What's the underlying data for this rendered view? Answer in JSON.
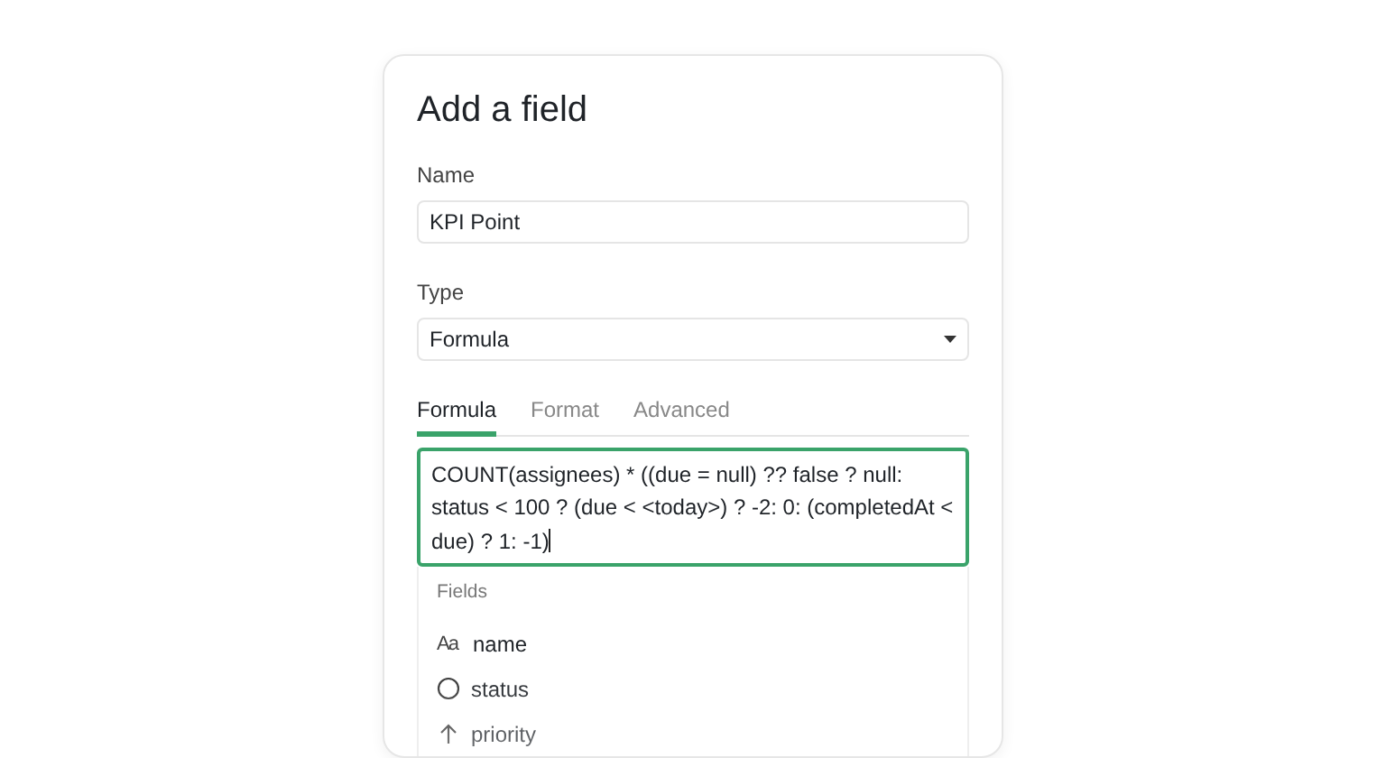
{
  "dialog": {
    "title": "Add a field"
  },
  "name_field": {
    "label": "Name",
    "value": "KPI Point"
  },
  "type_field": {
    "label": "Type",
    "value": "Formula"
  },
  "tabs": [
    {
      "label": "Formula",
      "selected": true
    },
    {
      "label": "Format",
      "selected": false
    },
    {
      "label": "Advanced",
      "selected": false
    }
  ],
  "formula": {
    "value": "COUNT(assignees) * ((due = null) ?? false ? null: status < 100 ? (due < <today>) ? -2: 0: (completedAt < due) ? 1: -1)"
  },
  "suggestions": {
    "heading": "Fields",
    "items": [
      {
        "kind": "text",
        "glyph": "Aa",
        "label": "name"
      },
      {
        "kind": "status",
        "label": "status"
      },
      {
        "kind": "priority",
        "label": "priority"
      }
    ]
  }
}
